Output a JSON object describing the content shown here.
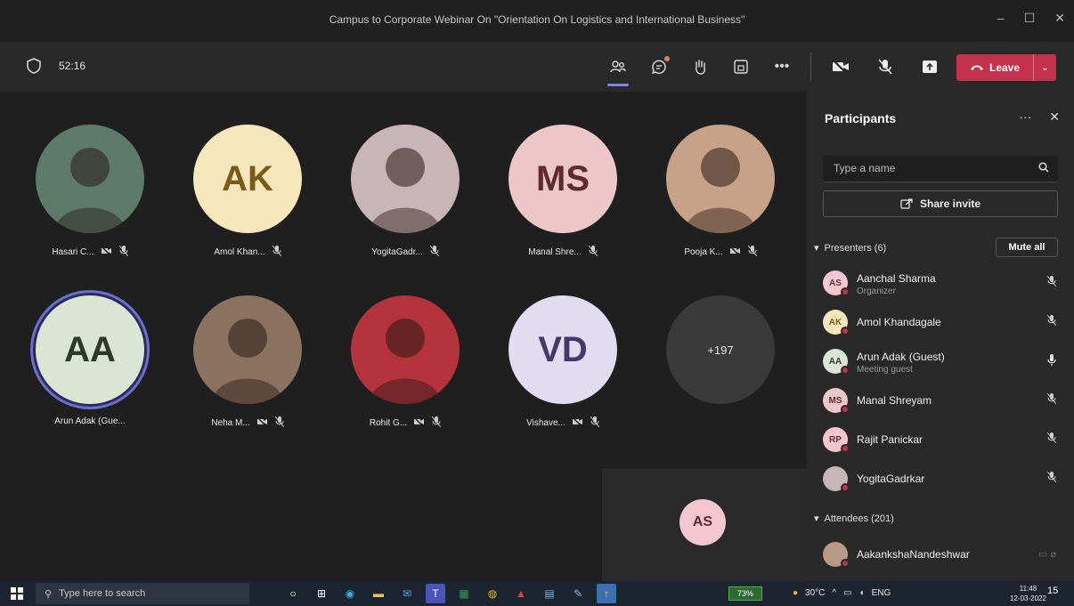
{
  "window": {
    "title": "Campus to Corporate Webinar On \"Orientation On Logistics and International Business\"",
    "controls": [
      "–",
      "☐",
      "✕"
    ]
  },
  "toolbar": {
    "timer": "52:16",
    "leave_label": "Leave",
    "accent": "#c4314b",
    "active_indicator": "#7f85f5"
  },
  "tiles": [
    {
      "name": "Hasari C...",
      "initials": "",
      "photo": true,
      "bg": "#5d7a6b",
      "icons": [
        "camera-off-icon",
        "mic-off-icon"
      ]
    },
    {
      "name": "Amol Khan...",
      "initials": "AK",
      "photo": false,
      "bg": "#f8e7bd",
      "fg": "#7a5a17",
      "icons": [
        "mic-off-icon"
      ]
    },
    {
      "name": "YogitaGadr...",
      "initials": "",
      "photo": true,
      "bg": "#c9b4b8",
      "icons": [
        "mic-off-icon"
      ]
    },
    {
      "name": "Manal Shre...",
      "initials": "MS",
      "photo": false,
      "bg": "#ecc6c9",
      "fg": "#5e2b31",
      "icons": [
        "mic-off-icon"
      ]
    },
    {
      "name": "Pooja K...",
      "initials": "",
      "photo": true,
      "bg": "#c7a288",
      "icons": [
        "camera-off-icon",
        "mic-off-icon"
      ]
    },
    {
      "name": "Arun Adak (Gue...",
      "initials": "AA",
      "photo": false,
      "bg": "#dbe5d3",
      "fg": "#2d3b26",
      "speaking": true,
      "icons": []
    },
    {
      "name": "Neha M...",
      "initials": "",
      "photo": true,
      "bg": "#8c7260",
      "icons": [
        "camera-off-icon",
        "mic-off-icon"
      ]
    },
    {
      "name": "Rohit G...",
      "initials": "",
      "photo": true,
      "bg": "#b4333c",
      "icons": [
        "camera-off-icon",
        "mic-off-icon"
      ]
    },
    {
      "name": "Vishave...",
      "initials": "VD",
      "photo": false,
      "bg": "#e1dcef",
      "fg": "#433a6b",
      "icons": [
        "camera-off-icon",
        "mic-off-icon"
      ]
    },
    {
      "name": "",
      "initials": "+197",
      "photo": false,
      "bg": "#3a3a3a",
      "fg": "#e8e8e8",
      "overflow": true,
      "icons": []
    }
  ],
  "self_view": {
    "initials": "AS"
  },
  "panel": {
    "title": "Participants",
    "search_placeholder": "Type a name",
    "share_label": "Share invite",
    "presenters_label": "Presenters (6)",
    "mute_all_label": "Mute all",
    "attendees_label": "Attendees (201)",
    "presenters": [
      {
        "initials": "AS",
        "name": "Aanchal Sharma",
        "role": "Organizer",
        "bg": "#f4c6cf",
        "fg": "#6a2e3a",
        "status": "mic-off-icon"
      },
      {
        "initials": "AK",
        "name": "Amol Khandagale",
        "role": "",
        "bg": "#f8e7bd",
        "fg": "#7a5a17",
        "status": "mic-off-icon"
      },
      {
        "initials": "AA",
        "name": "Arun Adak (Guest)",
        "role": "Meeting guest",
        "bg": "#dbe5d3",
        "fg": "#2d3b26",
        "status": "mic-on-icon"
      },
      {
        "initials": "MS",
        "name": "Manal Shreyam",
        "role": "",
        "bg": "#ecc6c9",
        "fg": "#5e2b31",
        "status": "mic-off-icon"
      },
      {
        "initials": "RP",
        "name": "Rajit Panickar",
        "role": "",
        "bg": "#f4c6cf",
        "fg": "#6a2e3a",
        "status": "mic-off-icon"
      },
      {
        "initials": "",
        "name": "YogitaGadrkar",
        "role": "",
        "bg": "#c9b4b8",
        "fg": "#333",
        "status": "mic-off-icon"
      }
    ],
    "attendees": [
      {
        "initials": "",
        "name": "AakankshaNandeshwar",
        "role": "",
        "bg": "#b99a86",
        "fg": "#333",
        "status": "camera-mic-off-icon"
      }
    ]
  },
  "taskbar": {
    "search_placeholder": "Type here to search",
    "battery": "73%",
    "weather": "30°C",
    "lang": "ENG",
    "time": "11:48",
    "date": "12-03-2022",
    "notifications": "15"
  }
}
